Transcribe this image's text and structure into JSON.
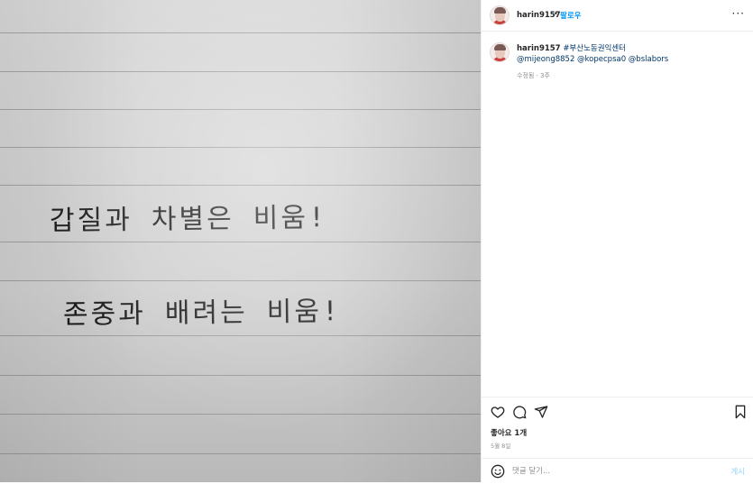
{
  "photo": {
    "line1": "갑질과 차별은 비움!",
    "line2": "존중과 배려는 비움!"
  },
  "header": {
    "username": "harin9157",
    "separator": "•",
    "follow_label": "팔로우",
    "more_label": "···"
  },
  "caption": {
    "username": "harin9157",
    "hashtag": "#부산노동권익센터",
    "mentions": "@mijeong8852 @kopecpsa0 @bslabors",
    "meta": "수정됨 · 3주"
  },
  "actions": {
    "likes": "좋아요 1개",
    "date": "5월 8일"
  },
  "comment": {
    "placeholder": "댓글 달기...",
    "post_label": "게시"
  },
  "colors": {
    "accent": "#0095f6",
    "link": "#00376b",
    "post_disabled": "#b2dffc"
  },
  "icons": [
    "heart-icon",
    "comment-icon",
    "share-icon",
    "bookmark-icon",
    "emoji-icon",
    "more-icon"
  ]
}
